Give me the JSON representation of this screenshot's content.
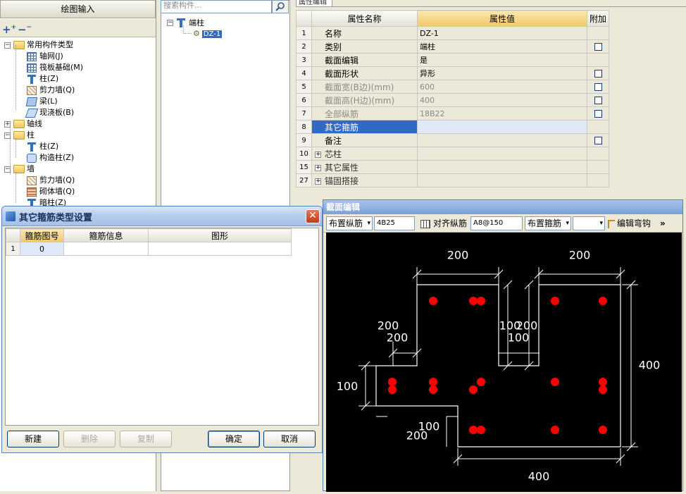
{
  "left_panel": {
    "title": "绘图输入",
    "add_icon": "plus-plus-icon",
    "remove_icon": "minus-minus-icon",
    "tree": [
      {
        "label": "常用构件类型",
        "icon": "folder-icon",
        "level": 0,
        "expander": "-"
      },
      {
        "label": "轴网(J)",
        "icon": "axis-grid-icon",
        "level": 1
      },
      {
        "label": "筏板基础(M)",
        "icon": "raft-foundation-icon",
        "level": 1
      },
      {
        "label": "柱(Z)",
        "icon": "column-icon",
        "level": 1
      },
      {
        "label": "剪力墙(Q)",
        "icon": "shear-wall-icon",
        "level": 1
      },
      {
        "label": "梁(L)",
        "icon": "beam-icon",
        "level": 1
      },
      {
        "label": "现浇板(B)",
        "icon": "slab-icon",
        "level": 1
      },
      {
        "label": "轴线",
        "icon": "folder-icon",
        "level": 0,
        "expander": "+"
      },
      {
        "label": "柱",
        "icon": "folder-icon",
        "level": 0,
        "expander": "-"
      },
      {
        "label": "柱(Z)",
        "icon": "column-icon",
        "level": 1
      },
      {
        "label": "构造柱(Z)",
        "icon": "structural-column-icon",
        "level": 1
      },
      {
        "label": "墙",
        "icon": "folder-icon",
        "level": 0,
        "expander": "-"
      },
      {
        "label": "剪力墙(Q)",
        "icon": "shear-wall-icon",
        "level": 1
      },
      {
        "label": "砌体墙(Q)",
        "icon": "masonry-wall-icon",
        "level": 1
      },
      {
        "label": "暗柱(Z)",
        "icon": "hidden-column-icon",
        "level": 1
      }
    ]
  },
  "middle_panel": {
    "search_placeholder": "搜索构件...",
    "search_icon": "search-icon",
    "root_label": "端柱",
    "child_label": "DZ-1"
  },
  "property_editor": {
    "tab_label": "属性编辑",
    "headers": {
      "name": "属性名称",
      "value": "属性值",
      "add": "附加"
    },
    "rows": [
      {
        "num": "1",
        "name": "名称",
        "value": "DZ-1",
        "checkbox": false,
        "style": "normal"
      },
      {
        "num": "2",
        "name": "类别",
        "value": "端柱",
        "checkbox": true,
        "style": "normal"
      },
      {
        "num": "3",
        "name": "截面编辑",
        "value": "是",
        "checkbox": false,
        "style": "normal"
      },
      {
        "num": "4",
        "name": "截面形状",
        "value": "异形",
        "checkbox": true,
        "style": "normal"
      },
      {
        "num": "5",
        "name": "截面宽(B边)(mm)",
        "value": "600",
        "checkbox": true,
        "style": "gray"
      },
      {
        "num": "6",
        "name": "截面高(H边)(mm)",
        "value": "400",
        "checkbox": true,
        "style": "gray"
      },
      {
        "num": "7",
        "name": "全部纵筋",
        "value": "18B22",
        "checkbox": true,
        "style": "gray"
      },
      {
        "num": "8",
        "name": "其它箍筋",
        "value": "",
        "checkbox": false,
        "style": "selected"
      },
      {
        "num": "9",
        "name": "备注",
        "value": "",
        "checkbox": true,
        "style": "normal"
      },
      {
        "num": "10",
        "name": "芯柱",
        "value": "",
        "checkbox": false,
        "style": "group"
      },
      {
        "num": "15",
        "name": "其它属性",
        "value": "",
        "checkbox": false,
        "style": "group"
      },
      {
        "num": "27",
        "name": "锚固搭接",
        "value": "",
        "checkbox": false,
        "style": "group"
      }
    ]
  },
  "dialog": {
    "title": "其它箍筋类型设置",
    "close_icon": "close-icon",
    "headers": {
      "code": "箍筋图号",
      "info": "箍筋信息",
      "shape": "图形"
    },
    "rows": [
      {
        "num": "1",
        "code": "0",
        "info": "",
        "shape": ""
      }
    ],
    "buttons": {
      "new": "新建",
      "delete": "删除",
      "copy": "复制",
      "ok": "确定",
      "cancel": "取消"
    }
  },
  "section_editor": {
    "title": "截面编辑",
    "toolbar": {
      "place_longitudinal": "布置纵筋",
      "longitudinal_value": "4B25",
      "align_longitudinal": "对齐纵筋",
      "stirrup_value": "A8@150",
      "place_stirrup": "布置箍筋",
      "edit_hook": "编辑弯钩",
      "more": "»"
    },
    "dimension_labels": [
      "200",
      "200",
      "200",
      "100",
      "200",
      "200",
      "100",
      "100",
      "400",
      "100",
      "200",
      "400"
    ]
  },
  "colors": {
    "selection": "#316ac5",
    "rebar_dot": "#ff0000",
    "canvas_bg": "#000000",
    "outline": "#ffffff",
    "title_bar": "#a7c1e8"
  }
}
